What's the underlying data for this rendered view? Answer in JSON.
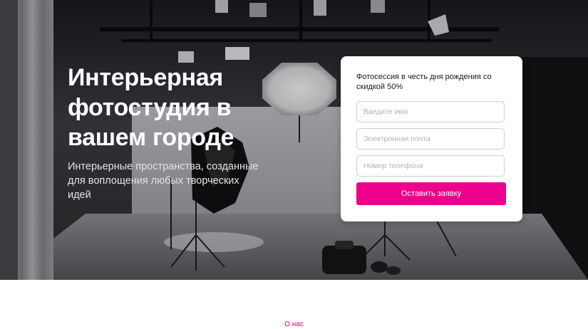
{
  "hero": {
    "title": "Интерьерная фотостудия в вашем городе",
    "subtitle": "Интерьерные пространства, созданные для воплощения любых творческих идей"
  },
  "form": {
    "title": "Фотосессия в честь дня рождения со скидкой 50%",
    "name_placeholder": "Введите имя",
    "email_placeholder": "Электронная почта",
    "phone_placeholder": "Номер телефона",
    "submit_label": "Оставить заявку"
  },
  "next_section": {
    "label": "О нас"
  },
  "colors": {
    "accent": "#ec008c",
    "hero_text": "#ffffff",
    "card_background": "#ffffff"
  }
}
